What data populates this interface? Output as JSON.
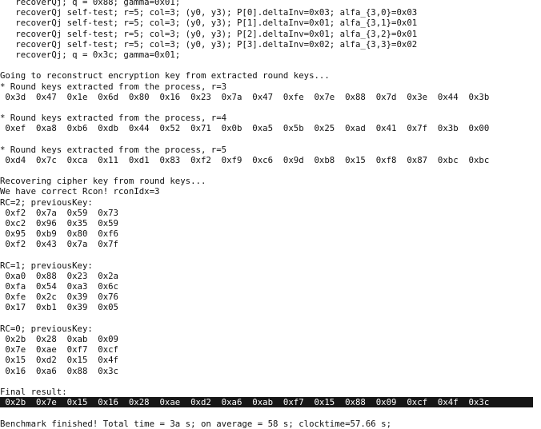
{
  "terminal": {
    "lines": [
      {
        "text": "   recoverQj; q = 0x88; gamma=0x01;"
      },
      {
        "text": "   recoverQj self-test; r=5; col=3; (y0, y3); P[0].deltaInv=0x03; alfa_{3,0}=0x03"
      },
      {
        "text": "   recoverQj self-test; r=5; col=3; (y0, y3); P[1].deltaInv=0x01; alfa_{3,1}=0x01"
      },
      {
        "text": "   recoverQj self-test; r=5; col=3; (y0, y3); P[2].deltaInv=0x01; alfa_{3,2}=0x01"
      },
      {
        "text": "   recoverQj self-test; r=5; col=3; (y0, y3); P[3].deltaInv=0x02; alfa_{3,3}=0x02"
      },
      {
        "text": "   recoverQj; q = 0x3c; gamma=0x01;"
      },
      {
        "text": ""
      },
      {
        "text": "Going to reconstruct encryption key from extracted round keys..."
      },
      {
        "text": "* Round keys extracted from the process, r=3"
      },
      {
        "text": " 0x3d  0x47  0x1e  0x6d  0x80  0x16  0x23  0x7a  0x47  0xfe  0x7e  0x88  0x7d  0x3e  0x44  0x3b"
      },
      {
        "text": ""
      },
      {
        "text": "* Round keys extracted from the process, r=4"
      },
      {
        "text": " 0xef  0xa8  0xb6  0xdb  0x44  0x52  0x71  0x0b  0xa5  0x5b  0x25  0xad  0x41  0x7f  0x3b  0x00"
      },
      {
        "text": ""
      },
      {
        "text": "* Round keys extracted from the process, r=5"
      },
      {
        "text": " 0xd4  0x7c  0xca  0x11  0xd1  0x83  0xf2  0xf9  0xc6  0x9d  0xb8  0x15  0xf8  0x87  0xbc  0xbc"
      },
      {
        "text": ""
      },
      {
        "text": "Recovering cipher key from round keys..."
      },
      {
        "text": "We have correct Rcon! rconIdx=3"
      },
      {
        "text": "RC=2; previousKey:"
      },
      {
        "text": " 0xf2  0x7a  0x59  0x73"
      },
      {
        "text": " 0xc2  0x96  0x35  0x59"
      },
      {
        "text": " 0x95  0xb9  0x80  0xf6"
      },
      {
        "text": " 0xf2  0x43  0x7a  0x7f"
      },
      {
        "text": ""
      },
      {
        "text": "RC=1; previousKey:"
      },
      {
        "text": " 0xa0  0x88  0x23  0x2a"
      },
      {
        "text": " 0xfa  0x54  0xa3  0x6c"
      },
      {
        "text": " 0xfe  0x2c  0x39  0x76"
      },
      {
        "text": " 0x17  0xb1  0x39  0x05"
      },
      {
        "text": ""
      },
      {
        "text": "RC=0; previousKey:"
      },
      {
        "text": " 0x2b  0x28  0xab  0x09"
      },
      {
        "text": " 0x7e  0xae  0xf7  0xcf"
      },
      {
        "text": " 0x15  0xd2  0x15  0x4f"
      },
      {
        "text": " 0x16  0xa6  0x88  0x3c"
      },
      {
        "text": ""
      },
      {
        "text": "Final result:"
      },
      {
        "text": " 0x2b  0x7e  0x15  0x16  0x28  0xae  0xd2  0xa6  0xab  0xf7  0x15  0x88  0x09  0xcf  0x4f  0x3c",
        "highlight": true
      },
      {
        "text": ""
      },
      {
        "text": "Benchmark finished! Total time = 3a s; on average = 58 s; clocktime=57.66 s;"
      }
    ]
  }
}
